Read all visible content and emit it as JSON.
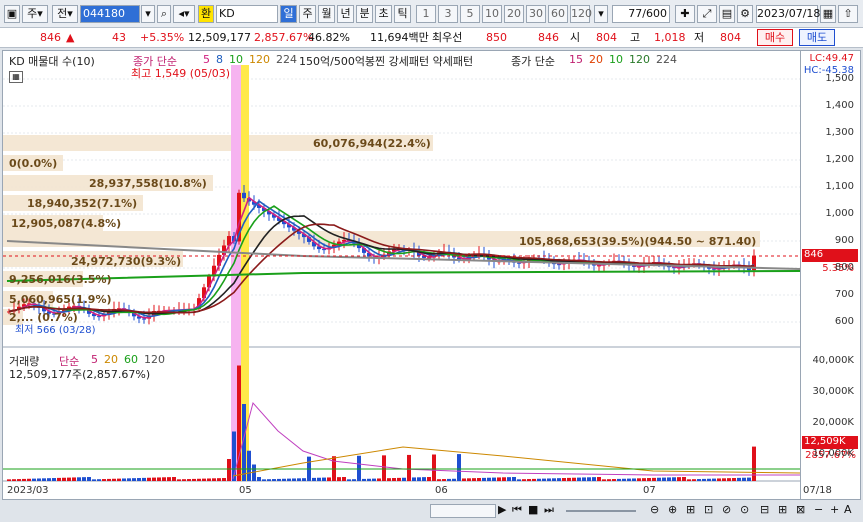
{
  "toolbar": {
    "market_label": "주",
    "full_label": "전",
    "code": "044180",
    "exchange_label": "환",
    "name": "KD",
    "periods": [
      "일",
      "주",
      "월",
      "년",
      "분",
      "초",
      "틱"
    ],
    "nums": [
      "1",
      "3",
      "5",
      "10",
      "20",
      "30",
      "60",
      "120"
    ],
    "count": "77",
    "total": "/600",
    "date": "2023/07/18"
  },
  "quote": {
    "price": "846",
    "arrow": "▲",
    "change": "43",
    "change_pct": "+5.35%",
    "volume": "12,509,177",
    "vol_ratio": "2,857.67%",
    "turnover": "46.82%",
    "value": "11,694백만",
    "best_label": "최우선",
    "ask": "850",
    "bid": "846",
    "open_label": "시",
    "open": "804",
    "high_label": "고",
    "high": "1,018",
    "low_label": "저",
    "low": "804",
    "buy_label": "매수",
    "sell_label": "매도"
  },
  "price_legend": {
    "name": "KD 매물대 수(10)",
    "ma_label": "종가 단순",
    "ma_periods": [
      "5",
      "8",
      "10",
      "120",
      "224"
    ],
    "extra": "150억/500억봉찐 강세패턴 약세패턴",
    "ma2_label": "종가 단순",
    "ma2_periods": [
      "15",
      "20",
      "10",
      "120",
      "224"
    ],
    "high_note": "최고 1,549 (05/03)",
    "low_note": "최저 566 (03/28)",
    "lc": "LC:49.47",
    "hc": "HC:-45.38",
    "price_tag": "846",
    "pct_tag": "5.35%"
  },
  "volume_profile": [
    {
      "label": "60,076,944(22.4%)"
    },
    {
      "label": "0(0.0%)"
    },
    {
      "label": "28,937,558(10.8%)"
    },
    {
      "label": "18,940,352(7.1%)"
    },
    {
      "label": "12,905,087(4.8%)"
    },
    {
      "label": "105,868,653(39.5%)(944.50 ~ 871.40)"
    },
    {
      "label": "24,972,730(9.3%)"
    },
    {
      "label": "9,256,016(3.5%)"
    },
    {
      "label": "5,060,965(1.9%)"
    },
    {
      "label": "2,... (0.7%)"
    }
  ],
  "price_axis": [
    "1,500",
    "1,400",
    "1,300",
    "1,200",
    "1,100",
    "1,000",
    "900",
    "800",
    "700",
    "600"
  ],
  "vol_legend": {
    "name": "거래량",
    "ma_label": "단순",
    "periods": [
      "5",
      "20",
      "60",
      "120"
    ],
    "value": "12,509,177주(2,857.67%)",
    "vol_tag": "12,509K",
    "vol_pct": "2857.67%"
  },
  "vol_axis": [
    "40,000K",
    "30,000K",
    "20,000K",
    "10,000K"
  ],
  "x_axis": [
    "2023/03",
    "05",
    "06",
    "07",
    "07/18"
  ]
}
